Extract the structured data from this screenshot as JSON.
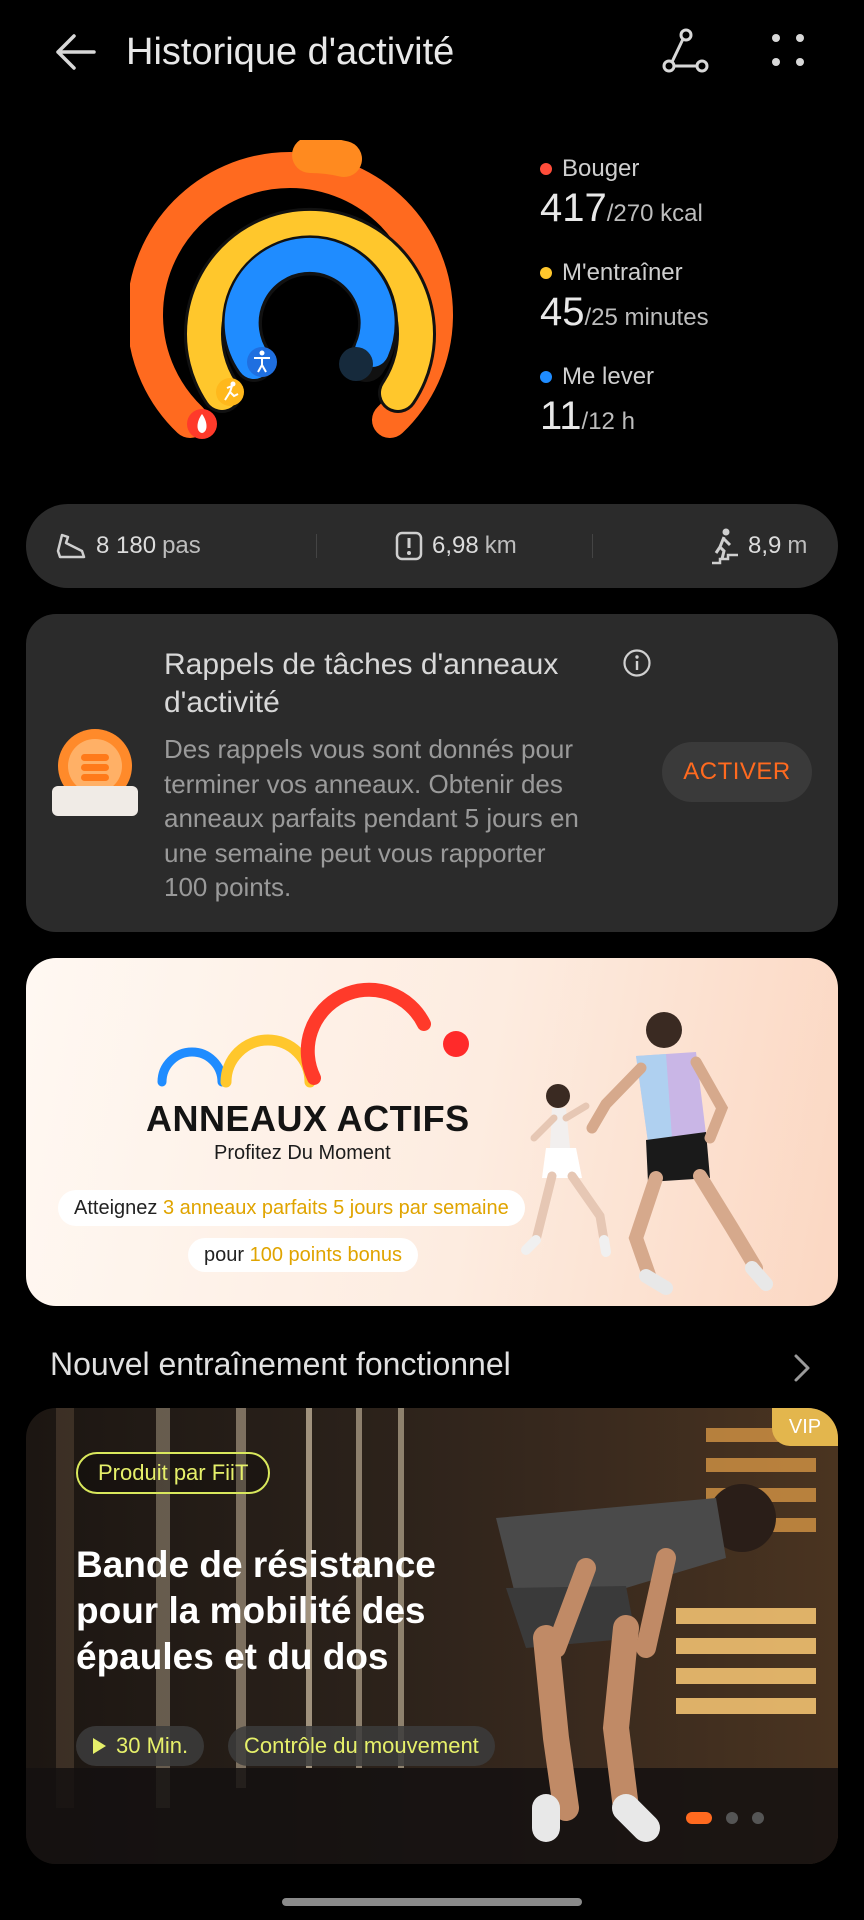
{
  "header": {
    "title": "Historique d'activité",
    "icons": {
      "back": "back-arrow-icon",
      "share": "share-route-icon",
      "more": "more-dots-icon"
    }
  },
  "rings": {
    "colors": {
      "move": "#ff5a2a",
      "exercise": "#ffc72c",
      "stand": "#1f8cff"
    },
    "progress": {
      "move": 1.54,
      "exercise": 1.8,
      "stand": 0.92
    }
  },
  "stats": [
    {
      "label": "Bouger",
      "value": "417",
      "goal": "/270 kcal",
      "color": "#ff5a2a"
    },
    {
      "label": "M'entraîner",
      "value": "45",
      "goal": "/25 minutes",
      "color": "#ffc72c"
    },
    {
      "label": "Me lever",
      "value": "11",
      "goal": "/12 h",
      "color": "#1f8cff"
    }
  ],
  "steps_bar": {
    "steps": {
      "value": "8 180",
      "unit": "pas",
      "icon": "shoe-icon"
    },
    "distance": {
      "value": "6,98",
      "unit": "km",
      "icon": "distance-icon"
    },
    "climb": {
      "value": "8,9",
      "unit": "m",
      "icon": "stairs-climb-icon"
    }
  },
  "reminder": {
    "title": "Rappels de tâches d'anneaux d'activité",
    "text": "Des rappels vous sont donnés pour terminer vos anneaux. Obtenir des anneaux parfaits pendant 5 jours en une semaine peut vous rapporter 100 points.",
    "button": "ACTIVER",
    "icon": "coin-reward-icon"
  },
  "banner": {
    "title": "ANNEAUX ACTIFS",
    "subtitle": "Profitez Du Moment",
    "line1_prefix": "Atteignez ",
    "line1_highlight": "3 anneaux parfaits 5 jours par semaine",
    "line2_prefix": "pour ",
    "line2_highlight": "100 points bonus"
  },
  "section": {
    "title": "Nouvel entraînement fonctionnel"
  },
  "workout": {
    "vip": "VIP",
    "producer": "Produit par FiiT",
    "title": "Bande de résistance pour la mobilité des épaules et du dos",
    "duration": "30 Min.",
    "tag": "Contrôle du mouvement",
    "pager": {
      "count": 3,
      "active": 0
    }
  }
}
